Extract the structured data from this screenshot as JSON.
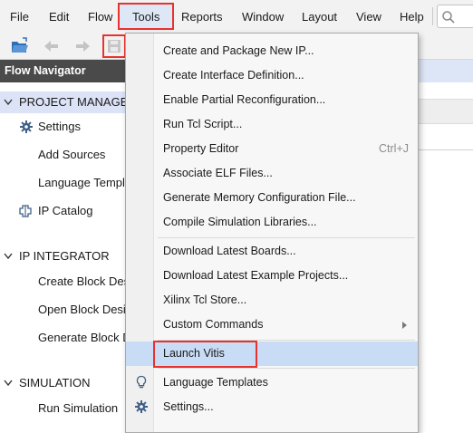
{
  "menubar": {
    "items": [
      {
        "key": "file",
        "label": "File"
      },
      {
        "key": "edit",
        "label": "Edit"
      },
      {
        "key": "flow",
        "label": "Flow"
      },
      {
        "key": "tools",
        "label": "Tools"
      },
      {
        "key": "reports",
        "label": "Reports"
      },
      {
        "key": "window",
        "label": "Window"
      },
      {
        "key": "layout",
        "label": "Layout"
      },
      {
        "key": "view",
        "label": "View"
      },
      {
        "key": "help",
        "label": "Help"
      }
    ],
    "search_icon": "search-icon"
  },
  "toolbar": {
    "icons": [
      "open-folder-icon",
      "undo-icon",
      "redo-icon",
      "save-icon"
    ]
  },
  "flow_navigator": {
    "title": "Flow Navigator",
    "sections": [
      {
        "label": "PROJECT MANAGER",
        "items": [
          {
            "label": "Settings",
            "icon": "gear-icon"
          },
          {
            "label": "Add Sources",
            "icon": ""
          },
          {
            "label": "Language Templa",
            "icon": ""
          },
          {
            "label": "IP Catalog",
            "icon": "ip-catalog-icon"
          }
        ]
      },
      {
        "label": "IP INTEGRATOR",
        "items": [
          {
            "label": "Create Block Desi"
          },
          {
            "label": "Open Block Desig"
          },
          {
            "label": "Generate Block D"
          }
        ]
      },
      {
        "label": "SIMULATION",
        "items": [
          {
            "label": "Run Simulation"
          }
        ]
      }
    ]
  },
  "tools_menu": {
    "items": [
      {
        "label": "Create and Package New IP...",
        "shortcut": "",
        "submenu": false,
        "icon": ""
      },
      {
        "label": "Create Interface Definition...",
        "shortcut": "",
        "submenu": false,
        "icon": ""
      },
      {
        "label": "Enable Partial Reconfiguration...",
        "shortcut": "",
        "submenu": false,
        "icon": ""
      },
      {
        "label": "Run Tcl Script...",
        "shortcut": "",
        "submenu": false,
        "icon": ""
      },
      {
        "label": "Property Editor",
        "shortcut": "Ctrl+J",
        "submenu": false,
        "icon": ""
      },
      {
        "label": "Associate ELF Files...",
        "shortcut": "",
        "submenu": false,
        "icon": ""
      },
      {
        "label": "Generate Memory Configuration File...",
        "shortcut": "",
        "submenu": false,
        "icon": ""
      },
      {
        "label": "Compile Simulation Libraries...",
        "shortcut": "",
        "submenu": false,
        "icon": ""
      },
      {
        "label": "Download Latest Boards...",
        "shortcut": "",
        "submenu": false,
        "icon": ""
      },
      {
        "label": "Download Latest Example Projects...",
        "shortcut": "",
        "submenu": false,
        "icon": ""
      },
      {
        "label": "Xilinx Tcl Store...",
        "shortcut": "",
        "submenu": false,
        "icon": ""
      },
      {
        "label": "Custom Commands",
        "shortcut": "",
        "submenu": true,
        "icon": ""
      },
      {
        "label": "Launch Vitis",
        "shortcut": "",
        "submenu": false,
        "icon": "",
        "highlighted": true
      },
      {
        "label": "Language Templates",
        "shortcut": "",
        "submenu": false,
        "icon": "lightbulb-icon"
      },
      {
        "label": "Settings...",
        "shortcut": "",
        "submenu": false,
        "icon": "gear-icon"
      }
    ]
  },
  "colors": {
    "highlight": "#c9dcf5",
    "annotation_red": "#e8322e",
    "nav_header": "#4a4a4a",
    "nav_selected": "#dde3f7"
  }
}
